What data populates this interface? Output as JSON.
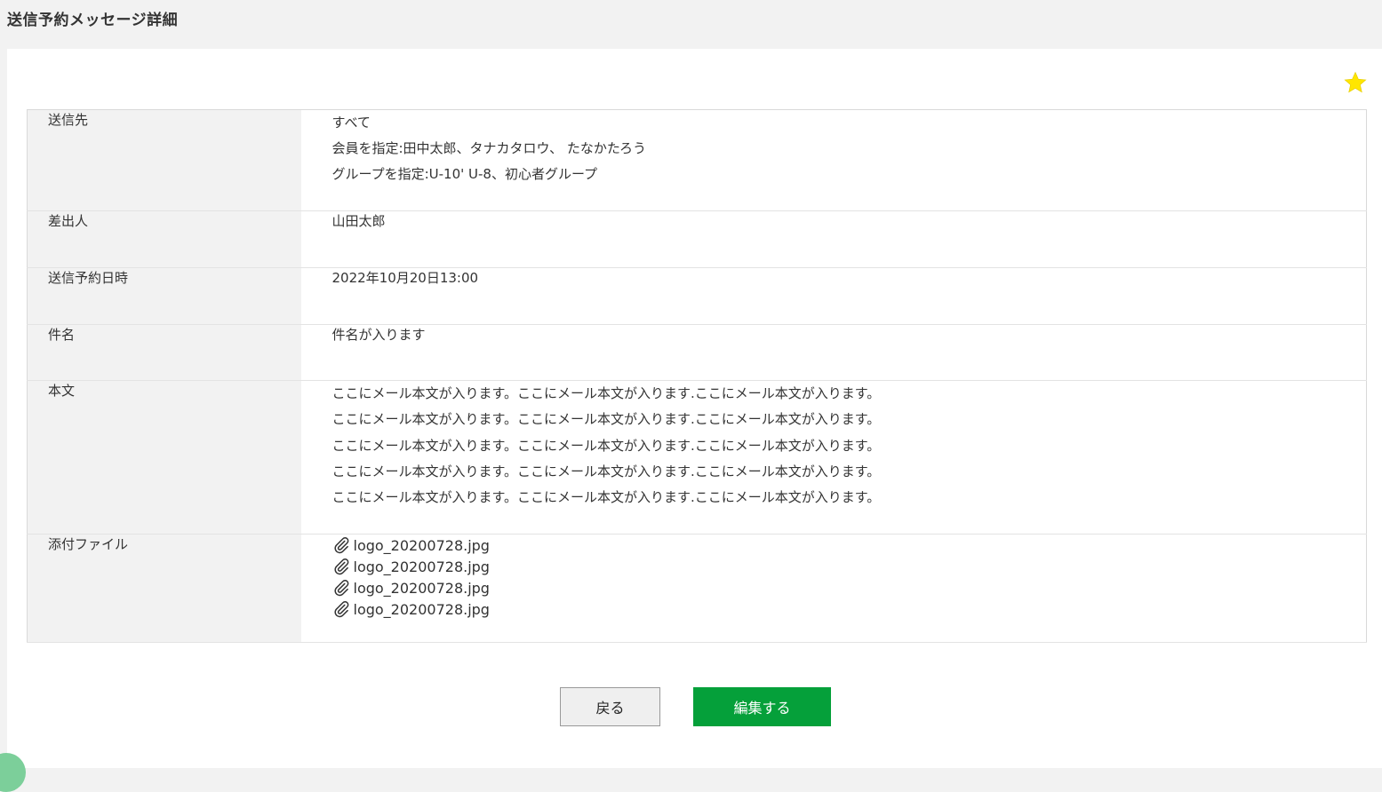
{
  "page": {
    "title": "送信予約メッセージ詳細"
  },
  "icons": {
    "favorite": "star-icon",
    "attachment": "paperclip-icon",
    "favorite_color": "#ffe600"
  },
  "fields": {
    "recipients": {
      "label": "送信先",
      "lines": [
        "すべて",
        "会員を指定:田中太郎、タナカタロウ、 たなかたろう",
        "グループを指定:U-10' U-8、初心者グループ"
      ]
    },
    "sender": {
      "label": "差出人",
      "value": "山田太郎"
    },
    "scheduled_at": {
      "label": "送信予約日時",
      "value": "2022年10月20日13:00"
    },
    "subject": {
      "label": "件名",
      "value": "件名が入ります"
    },
    "body": {
      "label": "本文",
      "lines": [
        "ここにメール本文が入ります。ここにメール本文が入ります.ここにメール本文が入ります。",
        "ここにメール本文が入ります。ここにメール本文が入ります.ここにメール本文が入ります。",
        "ここにメール本文が入ります。ここにメール本文が入ります.ここにメール本文が入ります。",
        "ここにメール本文が入ります。ここにメール本文が入ります.ここにメール本文が入ります。",
        "ここにメール本文が入ります。ここにメール本文が入ります.ここにメール本文が入ります。"
      ]
    },
    "attachments": {
      "label": "添付ファイル",
      "files": [
        "logo_20200728.jpg",
        "logo_20200728.jpg",
        "logo_20200728.jpg",
        "logo_20200728.jpg"
      ]
    }
  },
  "buttons": {
    "back_label": "戻る",
    "edit_label": "編集する",
    "edit_color": "#05a03a"
  }
}
